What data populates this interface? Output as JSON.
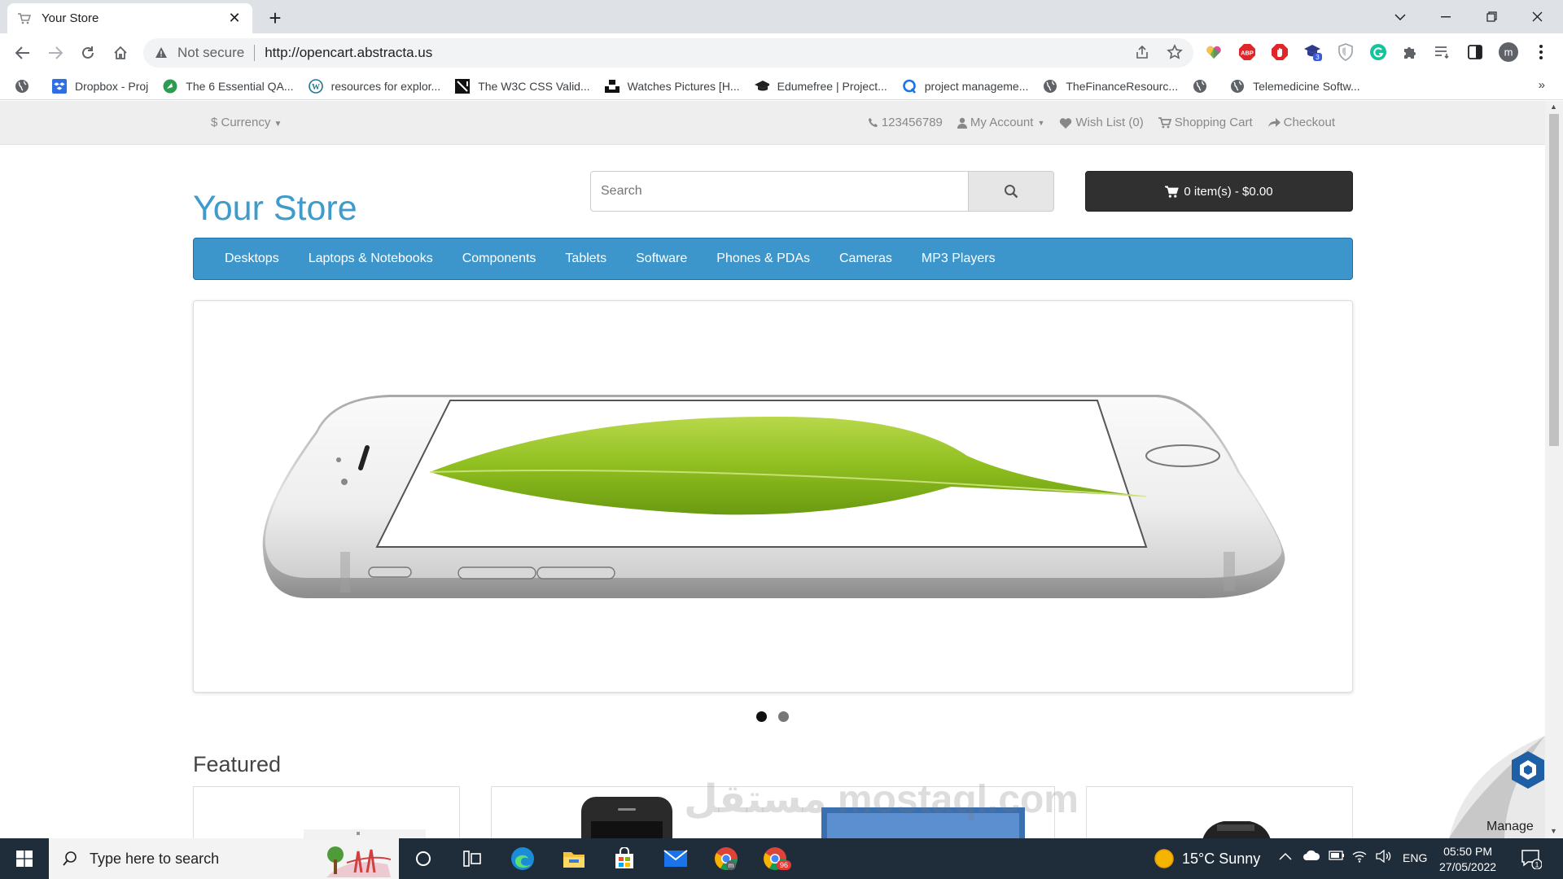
{
  "browser": {
    "tab_title": "Your Store",
    "not_secure": "Not secure",
    "url": "http://opencart.abstracta.us",
    "bookmarks": [
      {
        "label": "Dropbox - Proj",
        "icon": "dropbox-icon"
      },
      {
        "label": "The 6 Essential QA...",
        "icon": "qa-icon"
      },
      {
        "label": "resources for explor...",
        "icon": "wordpress-icon"
      },
      {
        "label": "The W3C CSS Valid...",
        "icon": "w3c-icon"
      },
      {
        "label": "Watches Pictures [H...",
        "icon": "unsplash-icon"
      },
      {
        "label": "Edumefree | Project...",
        "icon": "graduation-cap-icon"
      },
      {
        "label": "project manageme...",
        "icon": "q-icon"
      },
      {
        "label": "TheFinanceResourc...",
        "icon": "globe-icon"
      },
      {
        "label": "",
        "icon": "globe-icon"
      },
      {
        "label": "Telemedicine Softw...",
        "icon": "globe-icon"
      }
    ],
    "bookmarks_more": "»",
    "profile_initial": "m",
    "ext_badge": "3"
  },
  "store": {
    "currency": "$ Currency",
    "phone": "123456789",
    "my_account": "My Account",
    "wish_list": "Wish List (0)",
    "shopping_cart": "Shopping Cart",
    "checkout": "Checkout",
    "logo": "Your Store",
    "search_placeholder": "Search",
    "cart_button": "0 item(s) - $0.00",
    "menu": [
      "Desktops",
      "Laptops & Notebooks",
      "Components",
      "Tablets",
      "Software",
      "Phones & PDAs",
      "Cameras",
      "MP3 Players"
    ],
    "featured_title": "Featured",
    "manage_label": "Manage",
    "watermark": "مستقل mostaql.com"
  },
  "taskbar": {
    "search_placeholder": "Type here to search",
    "weather": "15°C  Sunny",
    "language": "ENG",
    "time": "05:50 PM",
    "date": "27/05/2022",
    "chrome_badge": "96",
    "notif_count": "1"
  },
  "colors": {
    "accent_blue": "#3c96cb",
    "logo_blue": "#3f9bcc",
    "cart_dark": "#303030",
    "taskbar": "#1f2c3a"
  }
}
